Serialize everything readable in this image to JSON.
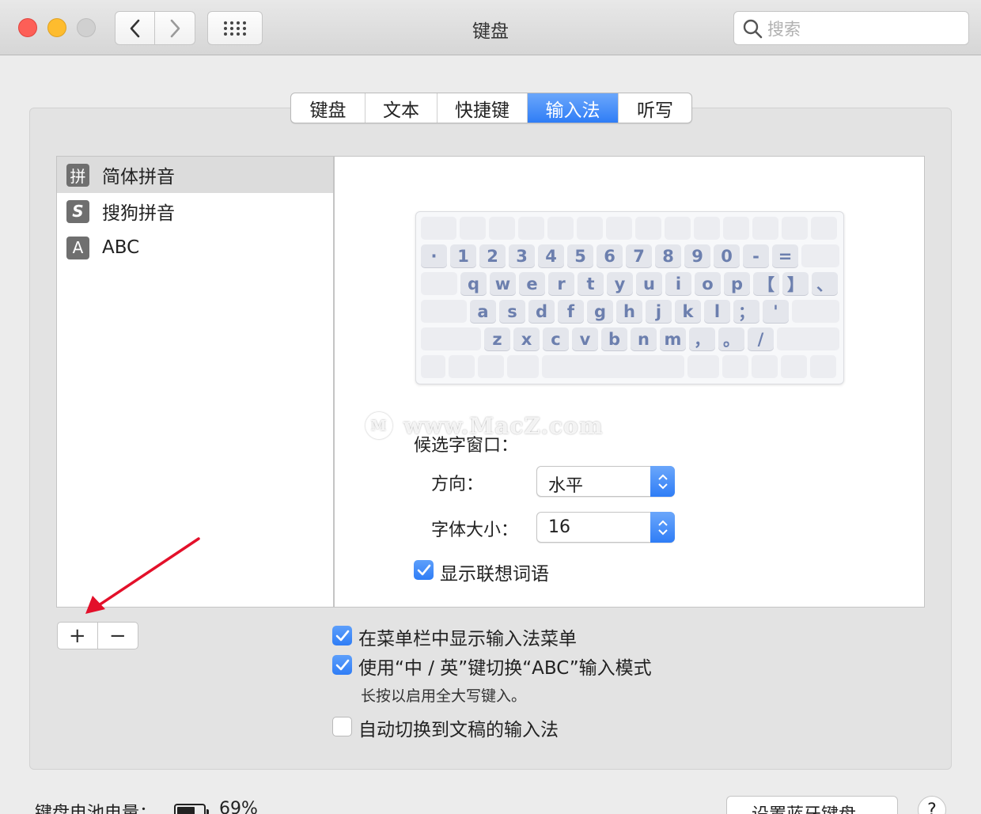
{
  "window": {
    "title": "键盘"
  },
  "search": {
    "placeholder": "搜索"
  },
  "tabs": [
    {
      "label": "键盘",
      "active": false
    },
    {
      "label": "文本",
      "active": false
    },
    {
      "label": "快捷键",
      "active": false
    },
    {
      "label": "输入法",
      "active": true
    },
    {
      "label": "听写",
      "active": false
    }
  ],
  "input_sources": [
    {
      "icon_text": "拼",
      "icon": "pinyin-icon",
      "label": "简体拼音",
      "selected": true
    },
    {
      "icon_text": "S",
      "icon": "sogou-icon",
      "label": "搜狗拼音",
      "selected": false
    },
    {
      "icon_text": "A",
      "icon": "abc-icon",
      "label": "ABC",
      "selected": false
    }
  ],
  "keyboard": {
    "row1": [
      "·",
      "1",
      "2",
      "3",
      "4",
      "5",
      "6",
      "7",
      "8",
      "9",
      "0",
      "-",
      "="
    ],
    "row2": [
      "q",
      "w",
      "e",
      "r",
      "t",
      "y",
      "u",
      "i",
      "o",
      "p",
      "【",
      "】",
      "、"
    ],
    "row3": [
      "a",
      "s",
      "d",
      "f",
      "g",
      "h",
      "j",
      "k",
      "l",
      "；",
      "'"
    ],
    "row4": [
      "z",
      "x",
      "c",
      "v",
      "b",
      "n",
      "m",
      "，",
      "。",
      "/"
    ]
  },
  "watermark": "www.MacZ.com",
  "candidate_window": {
    "title": "候选字窗口：",
    "direction_label": "方向：",
    "direction_value": "水平",
    "font_size_label": "字体大小：",
    "font_size_value": "16",
    "show_predictions_label": "显示联想词语",
    "show_predictions": true
  },
  "list_controls": {
    "add": "+",
    "remove": "−"
  },
  "options": {
    "show_in_menu_bar": {
      "label": "在菜单栏中显示输入法菜单",
      "checked": true
    },
    "toggle_abc": {
      "label": "使用“中 / 英”键切换“ABC”输入模式",
      "checked": true,
      "hint": "长按以启用全大写键入。"
    },
    "auto_switch": {
      "label": "自动切换到文稿的输入法",
      "checked": false
    }
  },
  "footer": {
    "battery_label": "键盘电池电量：",
    "battery_value": "69%",
    "battery_level": 0.69,
    "bluetooth_button": "设置蓝牙键盘...",
    "help": "?"
  },
  "colors": {
    "accent": "#2f7df6",
    "annotation_arrow": "#e3102a"
  }
}
